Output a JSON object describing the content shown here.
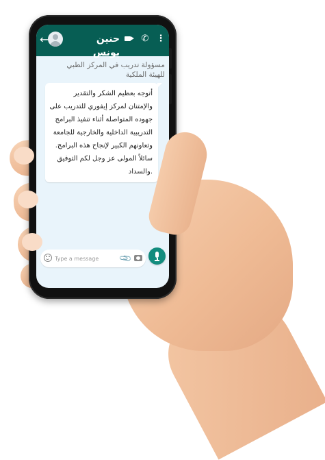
{
  "header": {
    "contact_name": "حنين يونس",
    "icons": [
      "back-arrow-icon",
      "avatar-icon",
      "video-call-icon",
      "phone-call-icon",
      "more-options-icon"
    ],
    "color": "#075e54"
  },
  "status": {
    "lines": [
      "مسؤولة تدريب في المركز الطبي",
      "للهيئة الملكية"
    ]
  },
  "message": {
    "lines": [
      "أتوجه بعظيم الشكر والتقدير",
      "والإمتنان لمركز إيفوري للتدريب على",
      "جهوده المتواصلة أثناء تنفيذ البرامج",
      "التدريبية الداخلية والخارجية للجامعة",
      "وتعاونهم الكبير لإنجاح هذه البرامج.",
      "سائلاً المولى عز وجل لكم التوفيق",
      ".والسداد"
    ]
  },
  "composer": {
    "placeholder": "Type a message",
    "value": "",
    "icons": [
      "emoji-icon",
      "attach-icon",
      "camera-icon",
      "mic-icon"
    ],
    "mic_color": "#128c7e"
  }
}
